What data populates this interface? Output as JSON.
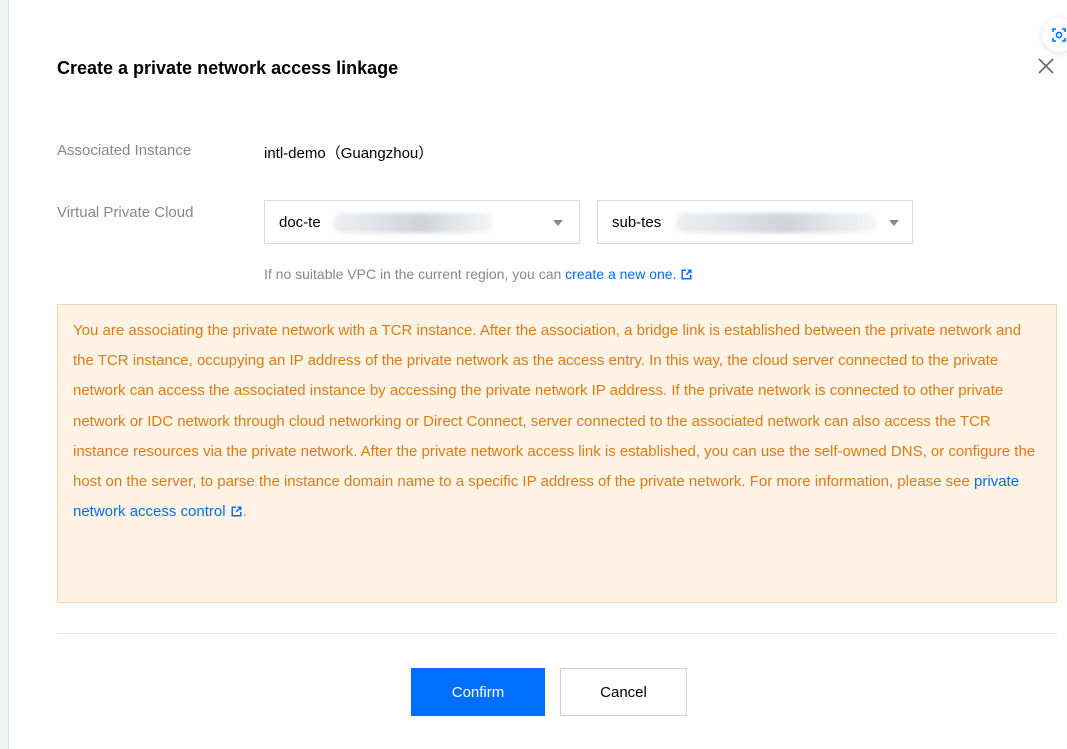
{
  "dialog": {
    "title": "Create a private network access linkage",
    "close_icon": "close-icon",
    "scan_icon": "scan-icon"
  },
  "form": {
    "instance_label": "Associated Instance",
    "instance_value": "intl-demo（Guangzhou）",
    "vpc_label": "Virtual Private Cloud",
    "vpc_select": "doc-te",
    "subnet_select": "sub-tes",
    "hint_text": "If no suitable VPC in the current region, you can ",
    "hint_link": "create a new one."
  },
  "notice": {
    "text": "You are associating the private network with a TCR instance. After the association, a bridge link is established between the private network and the TCR instance, occupying an IP address of the private network as the access entry. In this way, the cloud server connected to the private network can access the associated instance by accessing the private network IP address. If the private network is connected to other private network or IDC network through cloud networking or Direct Connect, server connected to the associated network can also access the TCR instance resources via the private network. After the private network access link is established, you can use the self-owned DNS, or configure the host on the server, to parse the instance domain name to a specific IP address of the private network. For more information, please see ",
    "link": "private network access control",
    "end": "."
  },
  "footer": {
    "confirm_label": "Confirm",
    "cancel_label": "Cancel"
  },
  "colors": {
    "primary": "#006eff",
    "notice_text": "#e07b14",
    "notice_bg": "#fff3e5",
    "notice_border": "#f7d6ad"
  }
}
